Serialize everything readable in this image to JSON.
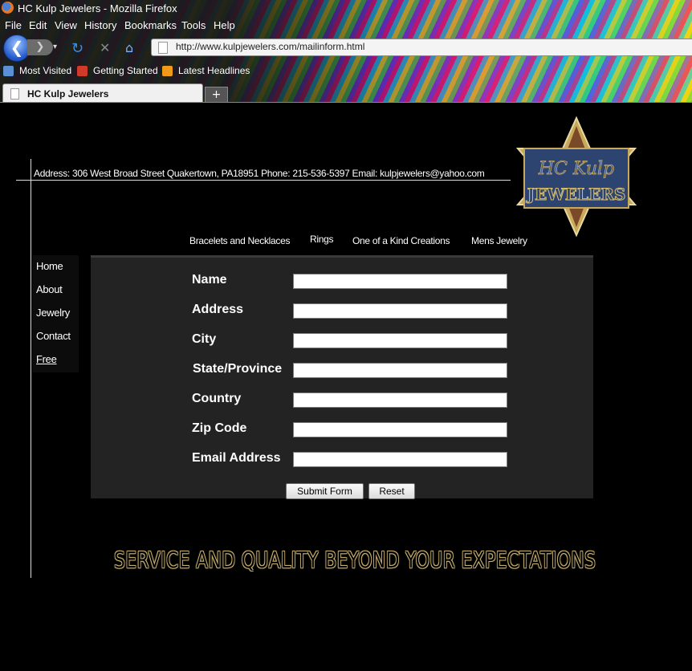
{
  "window": {
    "title": "HC Kulp Jewelers - Mozilla Firefox"
  },
  "menu": [
    "File",
    "Edit",
    "View",
    "History",
    "Bookmarks",
    "Tools",
    "Help"
  ],
  "nav": {
    "url": "http://www.kulpjewelers.com/mailinform.html"
  },
  "bookmarks": [
    "Most Visited",
    "Getting Started",
    "Latest Headlines"
  ],
  "tabs": [
    {
      "label": "HC Kulp Jewelers"
    }
  ],
  "new_tab_label": "+",
  "site": {
    "address_line": "Address: 306 West Broad Street Quakertown, PA18951    Phone: 215-536-5397   Email: kulpjewelers@yahoo.com",
    "logo": {
      "line1": "HC Kulp",
      "line2": "JEWELERS"
    },
    "top_nav": [
      "Bracelets and Necklaces",
      "Rings",
      "One of a Kind Creations",
      "Mens Jewelry"
    ],
    "side_nav": [
      "Home",
      "About",
      "Jewelry",
      "Contact",
      "Free"
    ],
    "form": {
      "labels": [
        "Name",
        "Address",
        "City",
        "State/Province",
        "Country",
        "Zip Code",
        "Email Address"
      ],
      "values": [
        "",
        "",
        "",
        "",
        "",
        "",
        ""
      ],
      "submit_label": "Submit Form",
      "reset_label": "Reset"
    },
    "slogan": "SERVICE AND QUALITY BEYOND YOUR EXPECTATIONS"
  },
  "colors": {
    "page_background": "#000000",
    "form_panel": "#232323",
    "slogan_outline": "#c8b070",
    "logo_gold": "#c8a85a",
    "logo_blue": "#2e4470"
  }
}
